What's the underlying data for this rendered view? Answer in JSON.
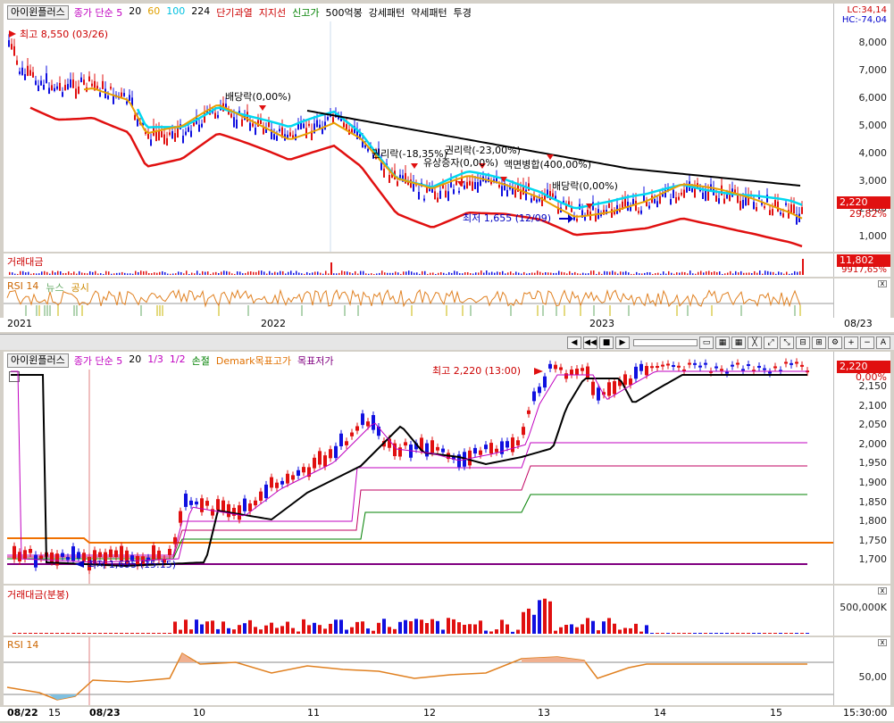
{
  "top": {
    "stock_name": "아이윈플러스",
    "legend": [
      {
        "text": "종가 단순 5",
        "color": "#c000c0"
      },
      {
        "text": "20",
        "color": "#000000"
      },
      {
        "text": "60",
        "color": "#e0a000"
      },
      {
        "text": "100",
        "color": "#00c0e0"
      },
      {
        "text": "224",
        "color": "#000000"
      },
      {
        "text": "단기과열",
        "color": "#cc0000"
      },
      {
        "text": "지지선",
        "color": "#cc0000"
      },
      {
        "text": "신고가",
        "color": "#008000"
      },
      {
        "text": "500억봉",
        "color": "#000000"
      },
      {
        "text": "강세패턴",
        "color": "#000000"
      },
      {
        "text": "약세패턴",
        "color": "#000000"
      },
      {
        "text": "투경",
        "color": "#000000"
      }
    ],
    "lc": "LC:34,14",
    "hc": "HC:-74,04",
    "yticks": [
      "8,000",
      "7,000",
      "6,000",
      "5,000",
      "4,000",
      "3,000",
      "2,000",
      "1,000"
    ],
    "price_tag": "2,220",
    "pct_tag": "29,82%",
    "annotations": {
      "high": "최고 8,550 (03/26)",
      "low": "최저 1,655 (12/09)",
      "div1": "배당락(0,00%)",
      "div2": "배당락(0,00%)",
      "right1": "권리락(-18,35%)",
      "right2": "권리락(-23,00%)",
      "paid": "유상증자(0,00%)",
      "face": "액면병합(400,00%)"
    },
    "vol_label": "거래대금",
    "vol_tag": "11,802",
    "vol_pct": "9917,65%",
    "rsi_label": "RSI 14",
    "news_label": "뉴스",
    "disclosure_label": "공시",
    "dates": [
      "2021",
      "2022",
      "2023"
    ],
    "right_date": "08/23"
  },
  "bottom": {
    "stock_name": "아이윈플러스",
    "legend": [
      {
        "text": "종가 단순 5",
        "color": "#c000c0"
      },
      {
        "text": "20",
        "color": "#000000"
      },
      {
        "text": "1/3",
        "color": "#c000c0"
      },
      {
        "text": "1/2",
        "color": "#c000c0"
      },
      {
        "text": "손절",
        "color": "#008000"
      },
      {
        "text": "Demark목표고가",
        "color": "#e07000"
      },
      {
        "text": "목표저가",
        "color": "#800080"
      }
    ],
    "yticks": [
      "2,150",
      "2,100",
      "2,050",
      "2,000",
      "1,950",
      "1,900",
      "1,850",
      "1,800",
      "1,750",
      "1,700"
    ],
    "price_tag": "2,220",
    "pct_tag": "0,00%",
    "high": "최고 2,220 (13:00)",
    "low": "최저 1,695 (15:15)",
    "vol_label": "거래대금(분봉)",
    "vol_tick": "500,000K",
    "rsi_label": "RSI 14",
    "rsi_tick": "50,00",
    "dates": [
      "08/22",
      "15",
      "08/23",
      "10",
      "11",
      "12",
      "13",
      "14",
      "15"
    ],
    "time": "15:30:00"
  },
  "colors": {
    "up": "#e01010",
    "down": "#1010e0",
    "accent": "#cc0000"
  }
}
